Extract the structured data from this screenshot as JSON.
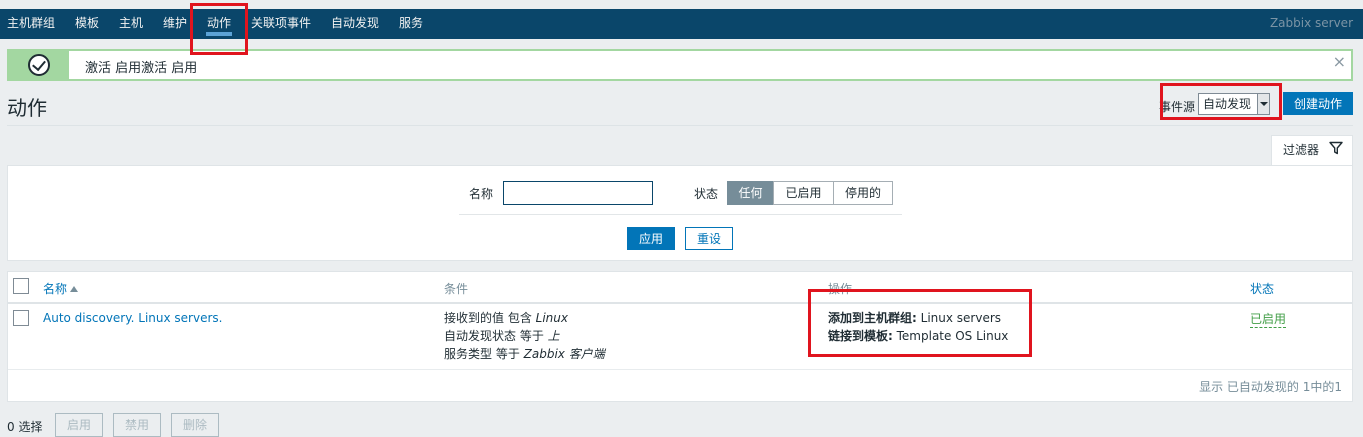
{
  "nav": {
    "items": [
      "主机群组",
      "模板",
      "主机",
      "维护",
      "动作",
      "关联项事件",
      "自动发现",
      "服务"
    ],
    "active": "动作",
    "brand": "Zabbix server"
  },
  "message": {
    "text": "激活 启用激活 启用",
    "close": "×"
  },
  "header": {
    "title": "动作",
    "event_source_label": "事件源",
    "event_source_value": "自动发现",
    "create_button": "创建动作"
  },
  "filter": {
    "tab_label": "过滤器",
    "name_label": "名称",
    "name_value": "",
    "status_label": "状态",
    "status_options": [
      "任何",
      "已启用",
      "停用的"
    ],
    "status_selected": "任何",
    "apply": "应用",
    "reset": "重设"
  },
  "table": {
    "headers": {
      "name": "名称",
      "conditions": "条件",
      "operations": "操作",
      "status": "状态"
    },
    "rows": [
      {
        "name": "Auto discovery. Linux servers.",
        "conditions": [
          {
            "prefix": "接收到的值 包含 ",
            "value": "Linux"
          },
          {
            "prefix": "自动发现状态 等于 ",
            "value": "上"
          },
          {
            "prefix": "服务类型 等于 ",
            "value": "Zabbix 客户端"
          }
        ],
        "operations": [
          {
            "label": "添加到主机群组:",
            "value": " Linux servers"
          },
          {
            "label": "链接到模板:",
            "value": " Template OS Linux"
          }
        ],
        "status": "已启用"
      }
    ],
    "footer": "显示 已自动发现的 1中的1"
  },
  "bulk": {
    "selected": "0 选择",
    "enable": "启用",
    "disable": "禁用",
    "delete": "删除"
  },
  "colors": {
    "nav_bg": "#0a466a",
    "accent": "#0275b8",
    "success": "#429e47",
    "highlight": "#e0141e"
  }
}
